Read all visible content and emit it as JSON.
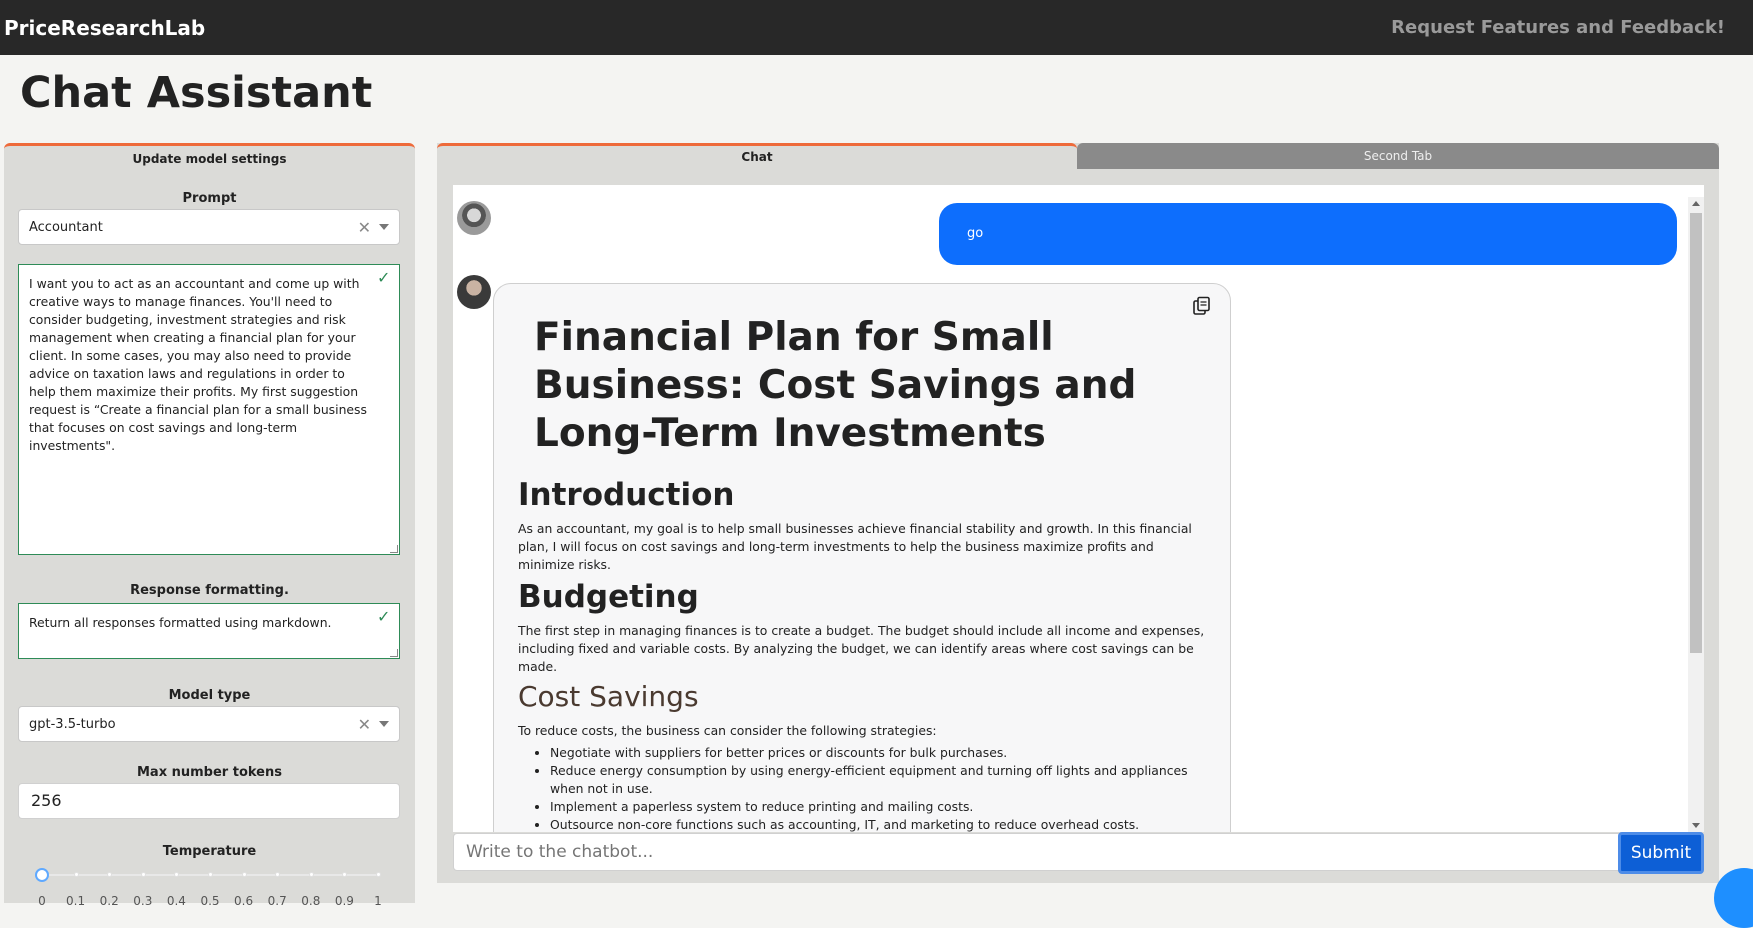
{
  "header": {
    "brand": "PriceResearchLab",
    "feedback_link": "Request Features and Feedback!"
  },
  "page_title": "Chat Assistant",
  "settings": {
    "title": "Update model settings",
    "prompt_label": "Prompt",
    "prompt_value": "Accountant",
    "prompt_text": "I want you to act as an accountant and come up with creative ways to manage finances. You'll need to consider budgeting, investment strategies and risk management when creating a financial plan for your client. In some cases, you may also need to provide advice on taxation laws and regulations in order to help them maximize their profits. My first suggestion request is “Create a financial plan for a small business that focuses on cost savings and long-term investments\".",
    "format_label": "Response formatting.",
    "format_text": "Return all responses formatted using markdown.",
    "model_label": "Model type",
    "model_value": "gpt-3.5-turbo",
    "tokens_label": "Max number tokens",
    "tokens_value": "256",
    "temperature_label": "Temperature",
    "temperature_value": 0,
    "temperature_ticks": [
      "0",
      "0.1",
      "0.2",
      "0.3",
      "0.4",
      "0.5",
      "0.6",
      "0.7",
      "0.8",
      "0.9",
      "1"
    ]
  },
  "tabs": {
    "chat": "Chat",
    "second": "Second Tab"
  },
  "chat": {
    "user_message": "go",
    "bot": {
      "h1": "Financial Plan for Small Business: Cost Savings and Long-Term Investments",
      "intro_heading": "Introduction",
      "intro_text": "As an accountant, my goal is to help small businesses achieve financial stability and growth. In this financial plan, I will focus on cost savings and long-term investments to help the business maximize profits and minimize risks.",
      "budget_heading": "Budgeting",
      "budget_text": "The first step in managing finances is to create a budget. The budget should include all income and expenses, including fixed and variable costs. By analyzing the budget, we can identify areas where cost savings can be made.",
      "savings_heading": "Cost Savings",
      "savings_intro": "To reduce costs, the business can consider the following strategies:",
      "savings_items": [
        "Negotiate with suppliers for better prices or discounts for bulk purchases.",
        "Reduce energy consumption by using energy-efficient equipment and turning off lights and appliances when not in use.",
        "Implement a paperless system to reduce printing and mailing costs.",
        "Outsource non-core functions such as accounting, IT, and marketing to reduce overhead costs."
      ]
    },
    "input_placeholder": "Write to the chatbot...",
    "submit_label": "Submit"
  },
  "colors": {
    "accent": "#ee6a3a",
    "user_bubble": "#0d6efd",
    "submit": "#0d5fd6",
    "valid_check": "#2e8b57"
  }
}
